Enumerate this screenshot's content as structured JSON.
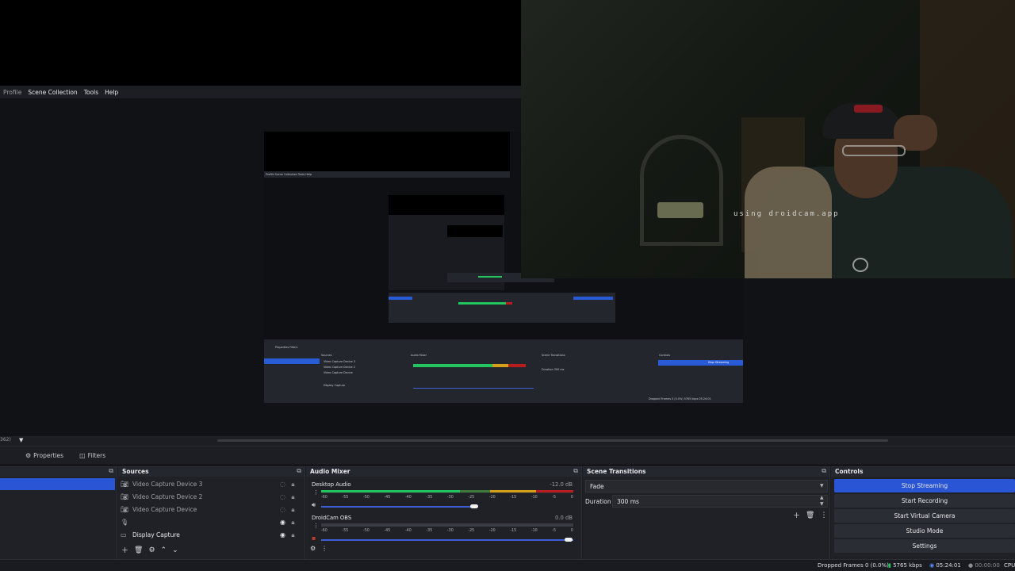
{
  "menubar": {
    "items": [
      "Profile",
      "Scene Collection",
      "Tools",
      "Help"
    ]
  },
  "webcam": {
    "watermark": "using droidcam.app"
  },
  "scene_hint": "362)",
  "propbar": {
    "properties_label": "Properties",
    "filters_label": "Filters"
  },
  "docks": {
    "sources": {
      "title": "Sources",
      "items": [
        {
          "label": "Video Capture Device 3",
          "icon": "camera-icon",
          "visible": false
        },
        {
          "label": "Video Capture Device 2",
          "icon": "camera-icon",
          "visible": false
        },
        {
          "label": "Video Capture Device",
          "icon": "camera-icon",
          "visible": false
        },
        {
          "label": "",
          "icon": "microphone-icon",
          "visible": true
        },
        {
          "label": "Display Capture",
          "icon": "monitor-icon",
          "visible": true
        }
      ]
    },
    "audio_mixer": {
      "title": "Audio Mixer",
      "channels": [
        {
          "name": "Desktop Audio",
          "db": "-12.0 dB"
        },
        {
          "name": "DroidCam OBS",
          "db": "0.0 dB"
        }
      ],
      "ticks": [
        "-60",
        "-55",
        "-50",
        "-45",
        "-40",
        "-35",
        "-30",
        "-25",
        "-20",
        "-15",
        "-10",
        "-5",
        "0"
      ]
    },
    "scene_transitions": {
      "title": "Scene Transitions",
      "transition": "Fade",
      "duration_label": "Duration",
      "duration_value": "300 ms"
    },
    "controls": {
      "title": "Controls",
      "buttons": [
        "Stop Streaming",
        "Start Recording",
        "Start Virtual Camera",
        "Studio Mode",
        "Settings"
      ]
    }
  },
  "status": {
    "dropped_frames": "Dropped Frames 0 (0.0%)",
    "bitrate": "5765 kbps",
    "stream_time": "05:24:01",
    "record_time": "00:00:00",
    "cpu": "CPU"
  },
  "colors": {
    "accent": "#2a55d4",
    "meter_green": "#22c55e",
    "meter_yellow": "#d4a017",
    "meter_red": "#b91c1c"
  }
}
